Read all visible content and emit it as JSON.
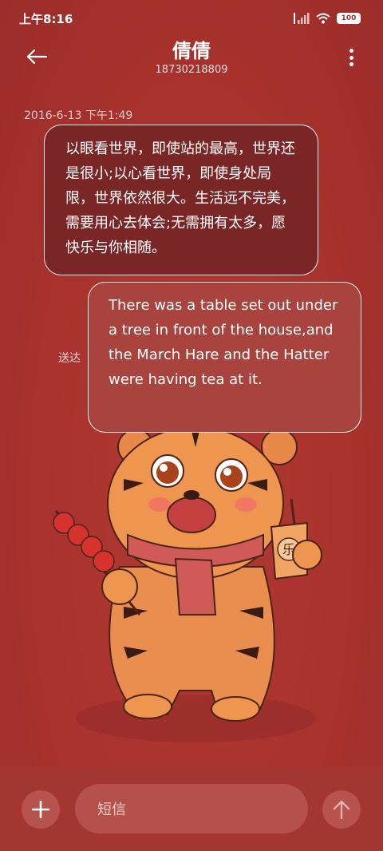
{
  "status_bar": {
    "time": "上午8:16",
    "battery": "100"
  },
  "header": {
    "title": "倩倩",
    "phone": "18730218809"
  },
  "conversation": {
    "timestamp": "2016-6-13 下午1:49",
    "messages": [
      {
        "text": "以眼看世界，即使站的最高，世界还是很小;以心看世界，即使身处局限，世界依然很大。生活远不完美，需要用心去体会;无需拥有太多，愿快乐与你相随。"
      },
      {
        "text": "There was a table set out under a tree in front of the house,and the March Hare and the Hatter were having tea at it."
      }
    ],
    "delivered_label": "送达"
  },
  "illustration": {
    "cup_label": "乐"
  },
  "input_bar": {
    "placeholder": "短信"
  },
  "icons": {
    "back": "back-arrow-icon",
    "more": "more-vertical-icon",
    "add": "plus-icon",
    "send": "send-arrow-icon",
    "signal": "signal-icon",
    "wifi": "wifi-icon",
    "battery": "battery-icon"
  },
  "colors": {
    "background": "#a8332f",
    "received_bubble": "#7a2627",
    "sent_bubble": "#a8443d",
    "input_bar": "#a33631",
    "input_field": "#b5504a"
  }
}
